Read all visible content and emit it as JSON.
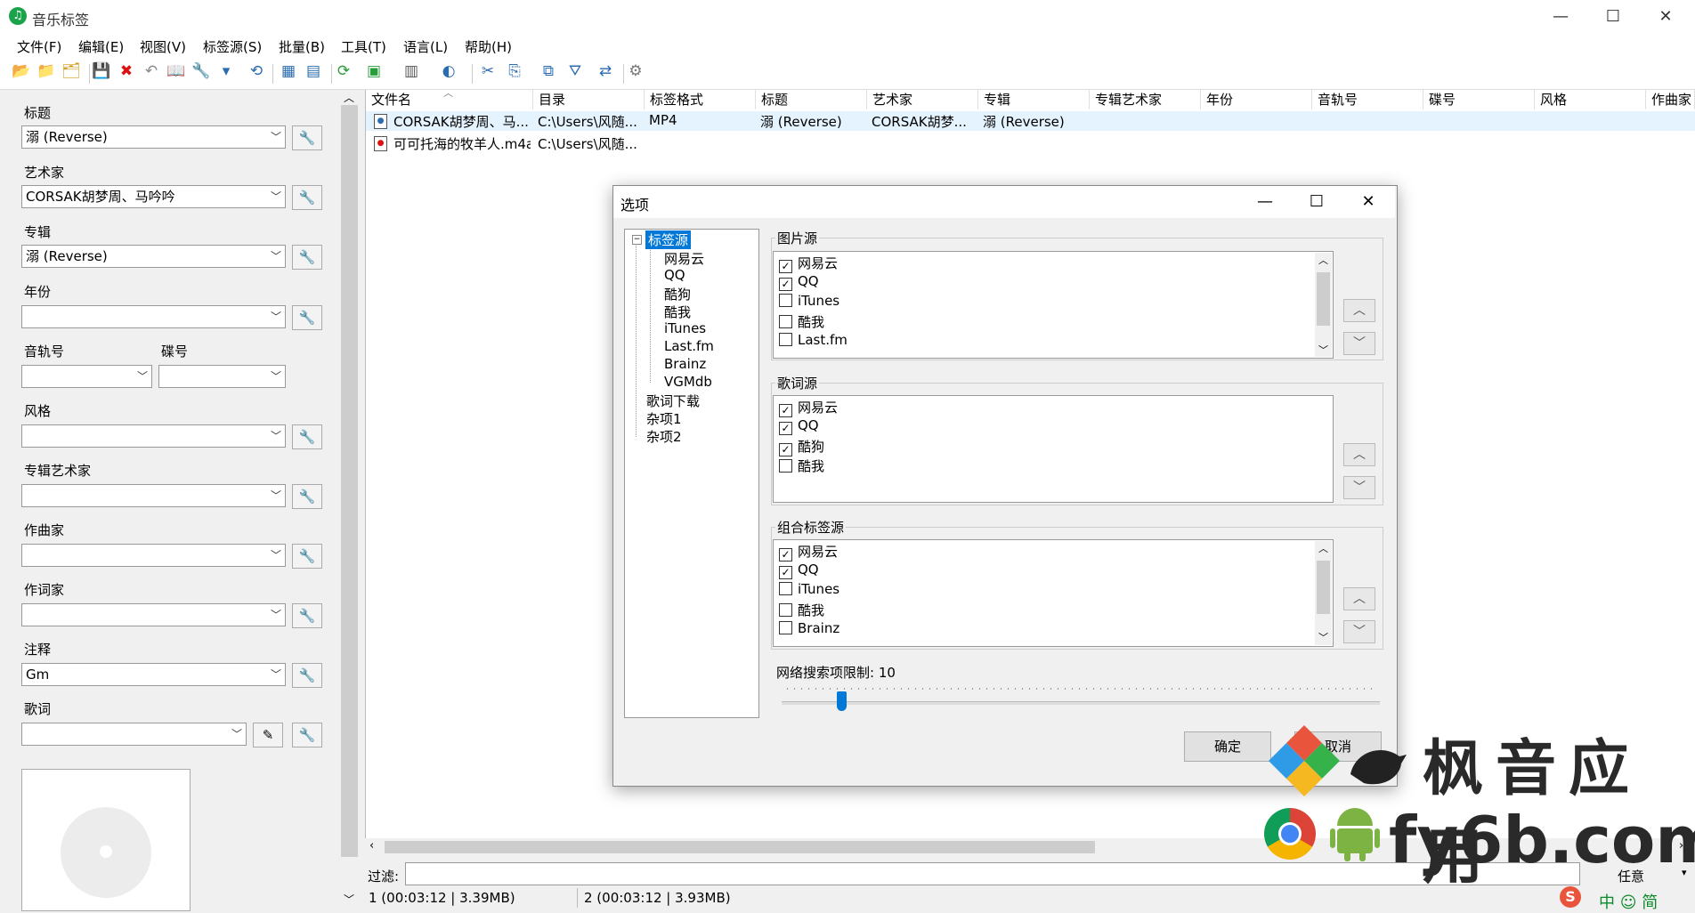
{
  "window": {
    "title": "音乐标签",
    "min_symbol": "—",
    "max_symbol": "☐",
    "close_symbol": "✕"
  },
  "menu": [
    "文件(F)",
    "编辑(E)",
    "视图(V)",
    "标签源(S)",
    "批量(B)",
    "工具(T)",
    "语言(L)",
    "帮助(H)"
  ],
  "toolbar_icons": [
    "open-folder-icon",
    "add-folder-icon",
    "open-files-icon",
    "save-icon",
    "delete-icon",
    "undo-icon",
    "book-icon",
    "wrench-icon",
    "tag-icon",
    "history-icon",
    "grid-icon",
    "table-icon",
    "refresh-icon",
    "image-icon",
    "abc-icon",
    "lyrics-icon",
    "tools-icon",
    "copy-icon",
    "batch-icon",
    "rename-icon",
    "settings-icon"
  ],
  "fields": {
    "title_label": "标题",
    "title_value": "溺 (Reverse)",
    "artist_label": "艺术家",
    "artist_value": "CORSAK胡梦周、马吟吟",
    "album_label": "专辑",
    "album_value": "溺 (Reverse)",
    "year_label": "年份",
    "year_value": "",
    "track_label": "音轨号",
    "track_value": "",
    "disc_label": "碟号",
    "disc_value": "",
    "genre_label": "风格",
    "genre_value": "",
    "album_artist_label": "专辑艺术家",
    "album_artist_value": "",
    "composer_label": "作曲家",
    "composer_value": "",
    "lyricist_label": "作词家",
    "lyricist_value": "",
    "comment_label": "注释",
    "comment_value": "Gm",
    "lyrics_label": "歌词",
    "lyrics_value": ""
  },
  "filelist": {
    "columns": [
      "文件名",
      "目录",
      "标签格式",
      "标题",
      "艺术家",
      "专辑",
      "专辑艺术家",
      "年份",
      "音轨号",
      "碟号",
      "风格",
      "作曲家"
    ],
    "rows": [
      [
        "CORSAK胡梦周、马...",
        "C:\\Users\\风随...",
        "MP4",
        "溺 (Reverse)",
        "CORSAK胡梦...",
        "溺 (Reverse)"
      ],
      [
        "可可托海的牧羊人.m4a",
        "C:\\Users\\风随...",
        "",
        "",
        "",
        ""
      ]
    ]
  },
  "filter": {
    "label": "过滤:",
    "mode": "任意"
  },
  "status": {
    "left": "1 (00:03:12 | 3.39MB)",
    "right": "2 (00:03:12 | 3.93MB)"
  },
  "dialog": {
    "title": "选项",
    "tree": {
      "root": "标签源",
      "children": [
        "网易云",
        "QQ",
        "酷狗",
        "酷我",
        "iTunes",
        "Last.fm",
        "Brainz",
        "VGMdb"
      ],
      "others": [
        "歌词下载",
        "杂项1",
        "杂项2"
      ]
    },
    "picture_source": {
      "title": "图片源",
      "items": [
        {
          "label": "网易云",
          "checked": true
        },
        {
          "label": "QQ",
          "checked": true
        },
        {
          "label": "iTunes",
          "checked": false
        },
        {
          "label": "酷我",
          "checked": false
        },
        {
          "label": "Last.fm",
          "checked": false
        }
      ]
    },
    "lyrics_source": {
      "title": "歌词源",
      "items": [
        {
          "label": "网易云",
          "checked": true
        },
        {
          "label": "QQ",
          "checked": true
        },
        {
          "label": "酷狗",
          "checked": true
        },
        {
          "label": "酷我",
          "checked": false
        }
      ]
    },
    "combined_source": {
      "title": "组合标签源",
      "items": [
        {
          "label": "网易云",
          "checked": true
        },
        {
          "label": "QQ",
          "checked": true
        },
        {
          "label": "iTunes",
          "checked": false
        },
        {
          "label": "酷我",
          "checked": false
        },
        {
          "label": "Brainz",
          "checked": false
        }
      ]
    },
    "search_limit_label": "网络搜索项限制: 10",
    "search_limit_value": 10,
    "ok": "确定",
    "cancel": "取消"
  },
  "watermark": {
    "line1": "枫音应用",
    "line2": "fy6b.com"
  },
  "ime": "中 ☺ 简"
}
